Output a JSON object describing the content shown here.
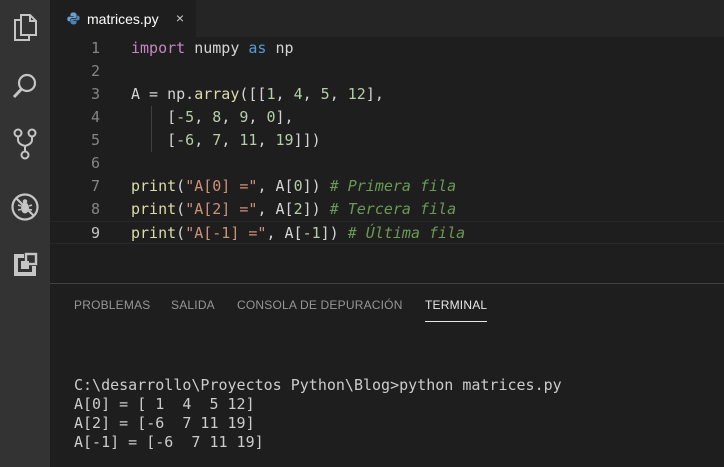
{
  "activity_bar": {
    "items": [
      {
        "icon": "files-icon"
      },
      {
        "icon": "search-icon"
      },
      {
        "icon": "source-control-icon"
      },
      {
        "icon": "debug-icon"
      },
      {
        "icon": "extensions-icon"
      }
    ],
    "color": "#c5c5c5"
  },
  "tab": {
    "file_name": "matrices.py",
    "close": "×",
    "icon": "python-file-icon"
  },
  "editor": {
    "lines": [
      {
        "num": "1",
        "tokens": [
          [
            "kw",
            "import"
          ],
          [
            "t",
            " numpy "
          ],
          [
            "op-kw",
            "as"
          ],
          [
            "t",
            " np"
          ]
        ]
      },
      {
        "num": "2",
        "tokens": []
      },
      {
        "num": "3",
        "tokens": [
          [
            "t",
            "A = np."
          ],
          [
            "fn",
            "array"
          ],
          [
            "t",
            "([["
          ],
          [
            "num",
            "1"
          ],
          [
            "t",
            ", "
          ],
          [
            "num",
            "4"
          ],
          [
            "t",
            ", "
          ],
          [
            "num",
            "5"
          ],
          [
            "t",
            ", "
          ],
          [
            "num",
            "12"
          ],
          [
            "t",
            "],"
          ]
        ]
      },
      {
        "num": "4",
        "tokens": [
          [
            "t",
            "    ["
          ],
          [
            "num",
            "-5"
          ],
          [
            "t",
            ", "
          ],
          [
            "num",
            "8"
          ],
          [
            "t",
            ", "
          ],
          [
            "num",
            "9"
          ],
          [
            "t",
            ", "
          ],
          [
            "num",
            "0"
          ],
          [
            "t",
            "],"
          ]
        ]
      },
      {
        "num": "5",
        "tokens": [
          [
            "t",
            "    ["
          ],
          [
            "num",
            "-6"
          ],
          [
            "t",
            ", "
          ],
          [
            "num",
            "7"
          ],
          [
            "t",
            ", "
          ],
          [
            "num",
            "11"
          ],
          [
            "t",
            ", "
          ],
          [
            "num",
            "19"
          ],
          [
            "t",
            "]])"
          ]
        ]
      },
      {
        "num": "6",
        "tokens": []
      },
      {
        "num": "7",
        "tokens": [
          [
            "fn",
            "print"
          ],
          [
            "t",
            "("
          ],
          [
            "str",
            "\"A[0] =\""
          ],
          [
            "t",
            ", A["
          ],
          [
            "num",
            "0"
          ],
          [
            "t",
            "]) "
          ],
          [
            "cmt",
            "# Primera fila"
          ]
        ]
      },
      {
        "num": "8",
        "tokens": [
          [
            "fn",
            "print"
          ],
          [
            "t",
            "("
          ],
          [
            "str",
            "\"A[2] =\""
          ],
          [
            "t",
            ", A["
          ],
          [
            "num",
            "2"
          ],
          [
            "t",
            "]) "
          ],
          [
            "cmt",
            "# Tercera fila"
          ]
        ]
      },
      {
        "num": "9",
        "tokens": [
          [
            "fn",
            "print"
          ],
          [
            "t",
            "("
          ],
          [
            "str",
            "\"A[-1] =\""
          ],
          [
            "t",
            ", A["
          ],
          [
            "num",
            "-1"
          ],
          [
            "t",
            "]) "
          ],
          [
            "cmt",
            "# Última fila"
          ]
        ]
      }
    ],
    "current_line": "9"
  },
  "panel": {
    "tabs": [
      {
        "label": "PROBLEMAS",
        "active": false
      },
      {
        "label": "SALIDA",
        "active": false
      },
      {
        "label": "CONSOLA DE DEPURACIÓN",
        "active": false
      },
      {
        "label": "TERMINAL",
        "active": true
      }
    ],
    "terminal_lines": [
      "C:\\desarrollo\\Proyectos Python\\Blog>python matrices.py",
      "A[0] = [ 1  4  5 12]",
      "A[2] = [-6  7 11 19]",
      "A[-1] = [-6  7 11 19]"
    ]
  }
}
